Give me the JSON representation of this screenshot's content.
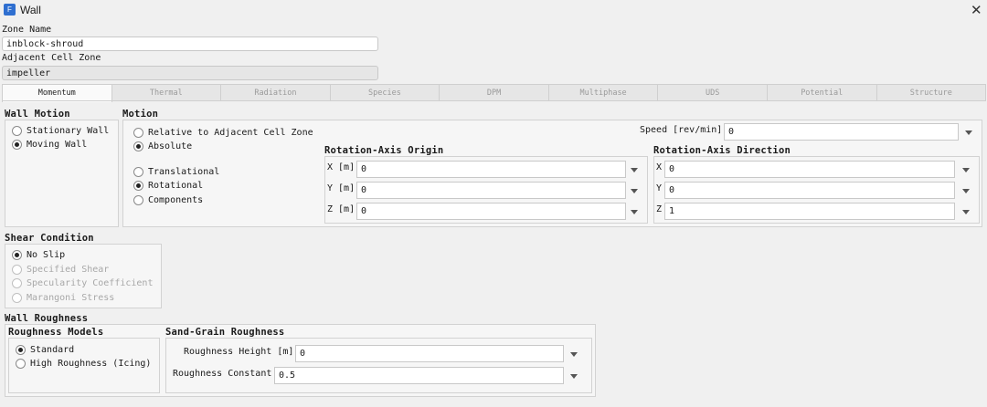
{
  "window": {
    "title": "Wall",
    "close_glyph": "✕",
    "icon": "app-icon"
  },
  "zone_name": {
    "label": "Zone Name",
    "value": "inblock-shroud"
  },
  "adjacent_cell_zone": {
    "label": "Adjacent Cell Zone",
    "value": "impeller"
  },
  "tabs": [
    "Momentum",
    "Thermal",
    "Radiation",
    "Species",
    "DPM",
    "Multiphase",
    "UDS",
    "Potential",
    "Structure"
  ],
  "active_tab": "Momentum",
  "wall_motion": {
    "title": "Wall Motion",
    "options": [
      {
        "label": "Stationary Wall",
        "selected": false
      },
      {
        "label": "Moving Wall",
        "selected": true
      }
    ]
  },
  "motion": {
    "title": "Motion",
    "reference": [
      {
        "label": "Relative to Adjacent Cell Zone",
        "selected": false
      },
      {
        "label": "Absolute",
        "selected": true
      }
    ],
    "type": [
      {
        "label": "Translational",
        "selected": false
      },
      {
        "label": "Rotational",
        "selected": true
      },
      {
        "label": "Components",
        "selected": false
      }
    ],
    "speed": {
      "label": "Speed [rev/min]",
      "value": "0"
    },
    "axis_origin": {
      "title": "Rotation-Axis Origin",
      "x": {
        "label": "X [m]",
        "value": "0"
      },
      "y": {
        "label": "Y [m]",
        "value": "0"
      },
      "z": {
        "label": "Z [m]",
        "value": "0"
      }
    },
    "axis_direction": {
      "title": "Rotation-Axis Direction",
      "x": {
        "label": "X",
        "value": "0"
      },
      "y": {
        "label": "Y",
        "value": "0"
      },
      "z": {
        "label": "Z",
        "value": "1"
      }
    }
  },
  "shear_condition": {
    "title": "Shear Condition",
    "options": [
      {
        "label": "No Slip",
        "selected": true,
        "enabled": true
      },
      {
        "label": "Specified Shear",
        "selected": false,
        "enabled": false
      },
      {
        "label": "Specularity Coefficient",
        "selected": false,
        "enabled": false
      },
      {
        "label": "Marangoni Stress",
        "selected": false,
        "enabled": false
      }
    ]
  },
  "wall_roughness": {
    "title": "Wall Roughness",
    "models": {
      "title": "Roughness Models",
      "options": [
        {
          "label": "Standard",
          "selected": true
        },
        {
          "label": "High Roughness (Icing)",
          "selected": false
        }
      ]
    },
    "sand_grain": {
      "title": "Sand-Grain Roughness",
      "height": {
        "label": "Roughness Height [m]",
        "value": "0"
      },
      "constant": {
        "label": "Roughness Constant",
        "value": "0.5"
      }
    }
  }
}
